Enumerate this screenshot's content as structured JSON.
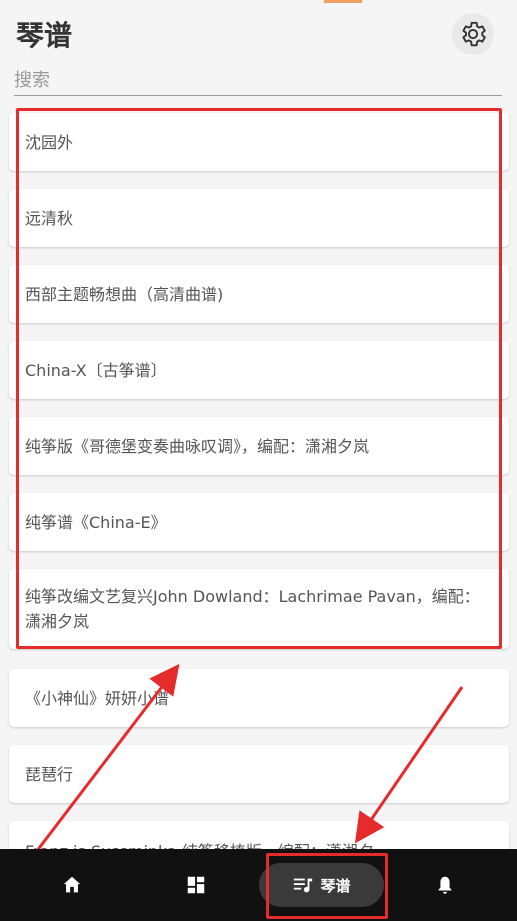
{
  "header": {
    "title": "琴谱"
  },
  "search": {
    "placeholder": "搜索",
    "value": ""
  },
  "scores": [
    "沈园外",
    "远清秋",
    "西部主题畅想曲（高清曲谱)",
    "China-X〔古筝谱〕",
    "纯筝版《哥德堡变奏曲咏叹调》，编配：潇湘夕岚",
    "纯筝谱《China-E》",
    "纯筝改编文艺复兴John Dowland：Lachrimae Pavan，编配：潇湘夕岚",
    "《小神仙》妍妍小谱",
    "琵琶行",
    "Franz is Sussminka                    纯筝移植版，编配：潇湘夕"
  ],
  "bottom_nav": {
    "items": [
      {
        "icon": "home-icon"
      },
      {
        "icon": "dashboard-icon"
      },
      {
        "icon": "music-list-icon",
        "label": "琴谱",
        "active": true
      },
      {
        "icon": "bell-icon"
      }
    ]
  },
  "annotation_color": "#e52b2b"
}
